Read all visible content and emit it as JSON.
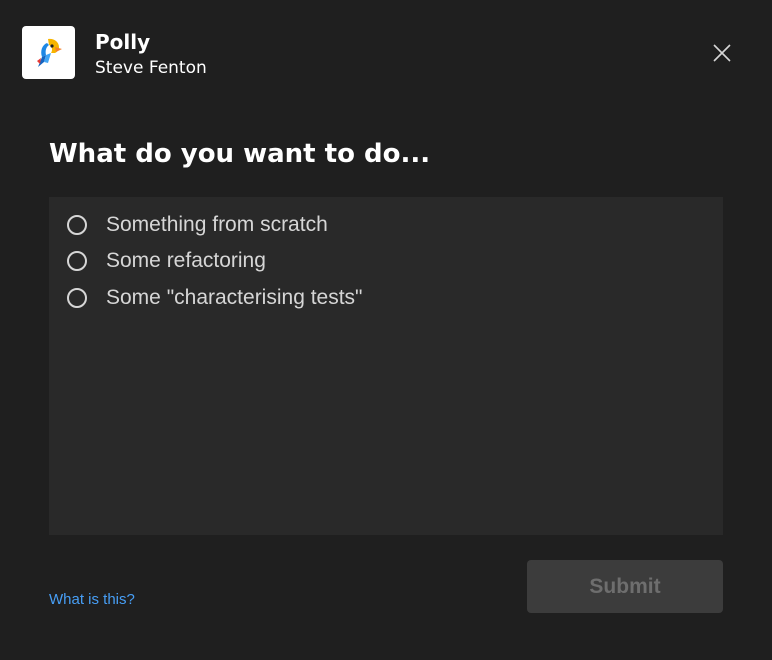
{
  "app": {
    "name": "Polly",
    "user": "Steve Fenton",
    "icon": "parrot-logo-icon"
  },
  "close": {
    "icon": "close-icon"
  },
  "question": "What do you want to do...",
  "options": [
    {
      "label": "Something from scratch",
      "selected": false
    },
    {
      "label": "Some refactoring",
      "selected": false
    },
    {
      "label": "Some \"characterising tests\"",
      "selected": false
    }
  ],
  "footer": {
    "help_link": "What is this?",
    "submit_label": "Submit",
    "submit_enabled": false
  },
  "colors": {
    "background": "#1f1f1f",
    "options_panel": "#292929",
    "link": "#479ef5",
    "submit_disabled_bg": "#3c3c3c",
    "submit_disabled_text": "#6e6e6e"
  }
}
